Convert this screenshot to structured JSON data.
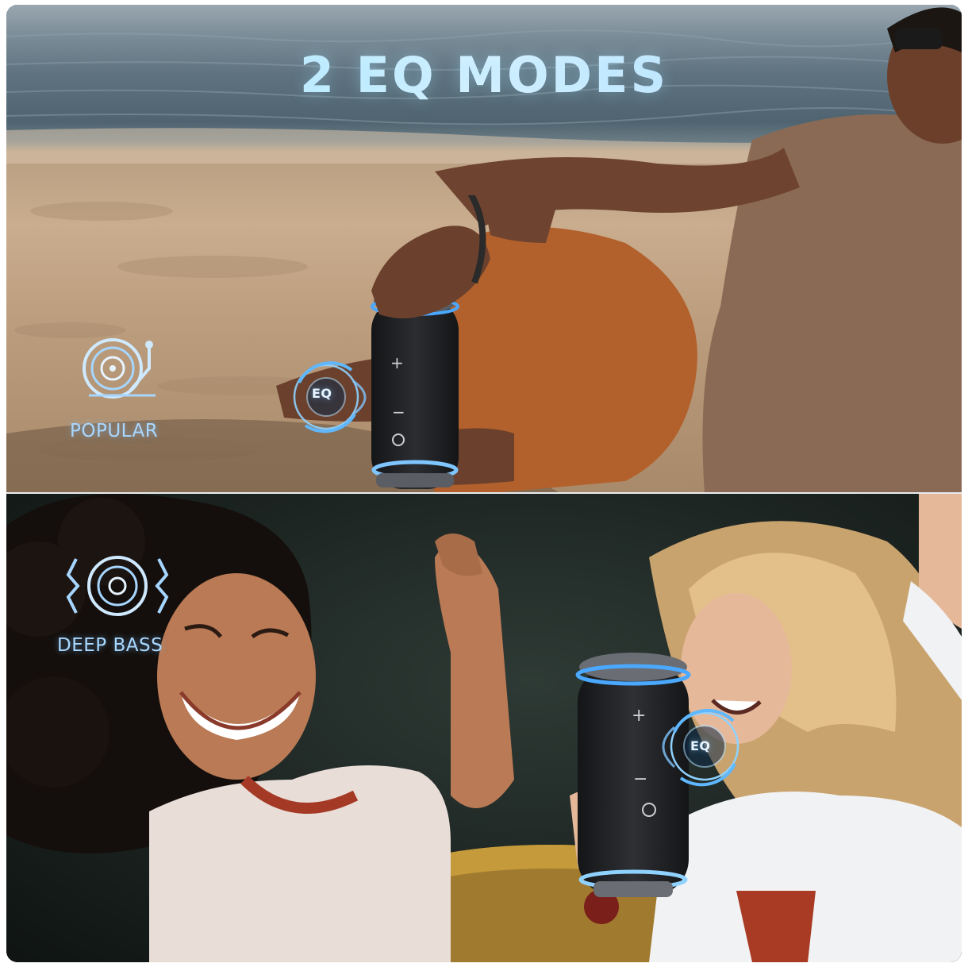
{
  "title": "2 EQ MODES",
  "modes": [
    {
      "label": "POPULAR",
      "icon": "turntable-icon"
    },
    {
      "label": "DEEP BASS",
      "icon": "bass-speaker-icon"
    }
  ],
  "eq_badge": "EQ",
  "speaker_buttons": [
    "+",
    "−"
  ],
  "colors": {
    "accent": "#7fc6ff",
    "title_gradient_start": "#9fe3ff",
    "title_gradient_end": "#a9d9ff",
    "speaker_body": "#1e1f22",
    "speaker_ring": "#4aa8ff"
  }
}
